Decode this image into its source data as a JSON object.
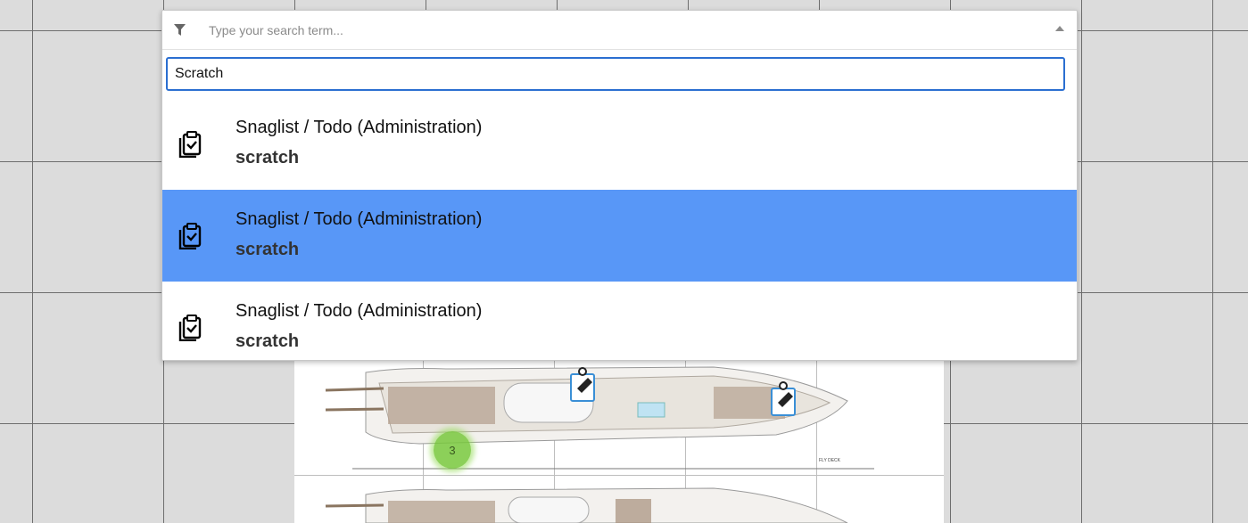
{
  "search": {
    "placeholder": "Type your search term...",
    "query": "Scratch"
  },
  "results": [
    {
      "title": "Snaglist / Todo (Administration)",
      "subtitle": "scratch",
      "icon": "clipboard-check-icon",
      "selected": false
    },
    {
      "title": "Snaglist / Todo (Administration)",
      "subtitle": "scratch",
      "icon": "clipboard-check-icon",
      "selected": true
    },
    {
      "title": "Snaglist / Todo (Administration)",
      "subtitle": "scratch",
      "icon": "clipboard-check-icon",
      "selected": false
    }
  ],
  "map": {
    "cluster_count": "3",
    "deck_label": "FLY DECK"
  },
  "colors": {
    "selected_row": "#5897f7",
    "focus_border": "#2b6fd1",
    "cluster_marker": "#78c83c",
    "snag_marker": "#3a8fd6"
  }
}
